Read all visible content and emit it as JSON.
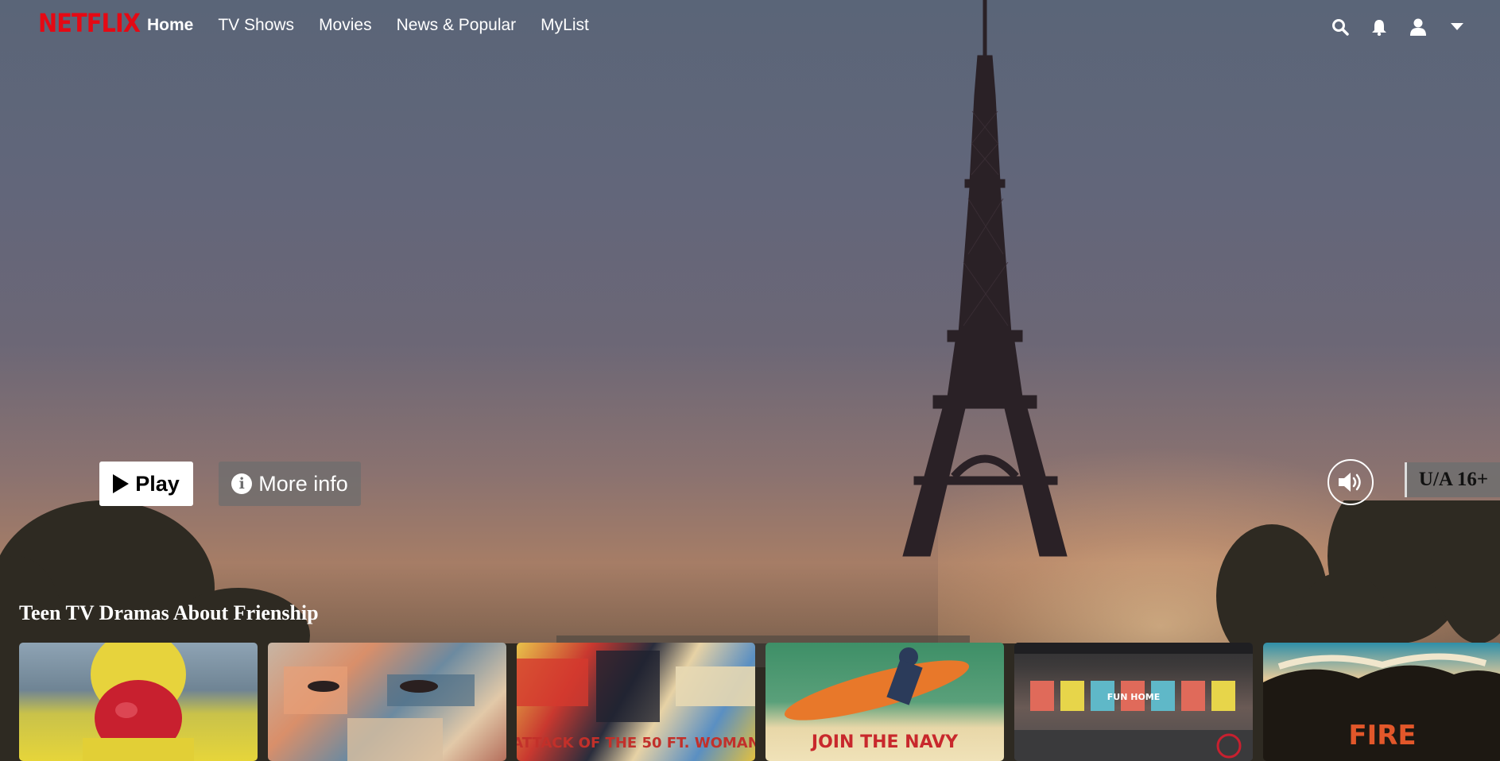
{
  "brand": {
    "logo": "NETFLIX",
    "color": "#e50914"
  },
  "nav": {
    "links": [
      {
        "label": "Home",
        "active": true
      },
      {
        "label": "TV Shows",
        "active": false
      },
      {
        "label": "Movies",
        "active": false
      },
      {
        "label": "News & Popular",
        "active": false
      },
      {
        "label": "MyList",
        "active": false
      }
    ],
    "icons": [
      "search-icon",
      "bell-icon",
      "user-icon",
      "caret-down-icon"
    ]
  },
  "hero": {
    "play_label": "Play",
    "info_label": "More info",
    "info_glyph": "i",
    "rating": "U/A 16+",
    "mute_icon": "volume-icon"
  },
  "row": {
    "title": "Teen TV Dramas About Frienship",
    "cards": [
      {
        "text": ""
      },
      {
        "text": ""
      },
      {
        "text": "ATTACK OF THE 50 FT. WOMAN"
      },
      {
        "text": "JOIN THE NAVY"
      },
      {
        "text": "FUN HOME"
      },
      {
        "text": "FIRE"
      }
    ]
  }
}
